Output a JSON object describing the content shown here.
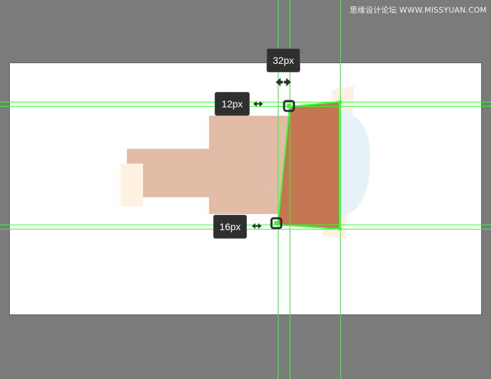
{
  "watermark": "思缘设计论坛 WWW.MISSYUAN.COM",
  "tooltips": {
    "width_label": "32px",
    "top_offset_label": "12px",
    "bottom_offset_label": "16px"
  },
  "colors": {
    "canvas_bg": "#7b7b7b",
    "artboard_bg": "#ffffff",
    "guide": "#33ff33",
    "selected_fill": "#c47653",
    "body_fill": "#e2bca7",
    "cap_fill": "#fff1e1",
    "lens_fill": "#e6f1f8"
  },
  "icons": {
    "width_arrow": "double-arrow-horizontal-icon",
    "top_arrow": "double-arrow-vertical-icon",
    "bottom_arrow": "double-arrow-vertical-icon",
    "anchor_handle": "anchor-point-icon"
  }
}
